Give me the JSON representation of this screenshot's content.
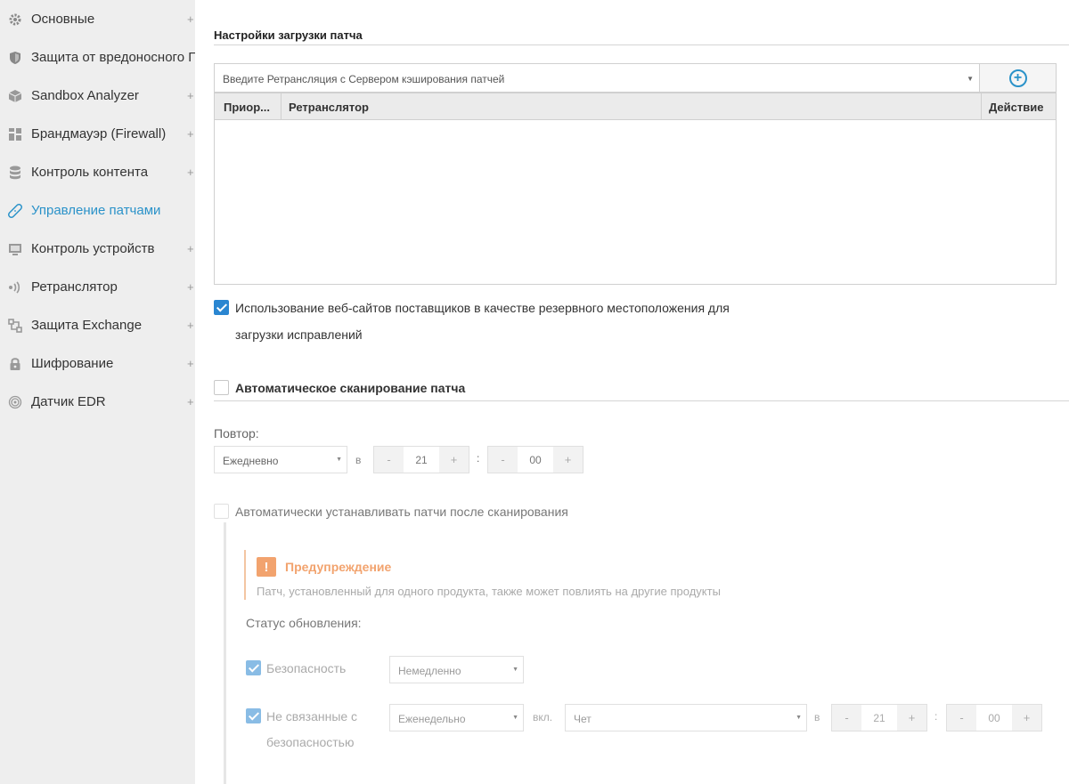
{
  "sidebar": {
    "items": [
      {
        "label": "Основные",
        "icon": "gear-icon",
        "plus": "+"
      },
      {
        "label": "Защита от вредоносного ПО",
        "icon": "shield-icon",
        "plus": "+"
      },
      {
        "label": "Sandbox Analyzer",
        "icon": "cube-icon",
        "plus": "+"
      },
      {
        "label": "Брандмауэр (Firewall)",
        "icon": "firewall-icon",
        "plus": "+"
      },
      {
        "label": "Контроль контента",
        "icon": "database-icon",
        "plus": "+"
      },
      {
        "label": "Управление патчами",
        "icon": "bandage-icon",
        "plus": ""
      },
      {
        "label": "Контроль устройств",
        "icon": "monitor-icon",
        "plus": "+"
      },
      {
        "label": "Ретранслятор",
        "icon": "broadcast-icon",
        "plus": "+"
      },
      {
        "label": "Защита Exchange",
        "icon": "exchange-icon",
        "plus": "+"
      },
      {
        "label": "Шифрование",
        "icon": "lock-icon",
        "plus": "+"
      },
      {
        "label": "Датчик EDR",
        "icon": "sensor-icon",
        "plus": "+"
      }
    ]
  },
  "main": {
    "section_title": "Настройки загрузки патча",
    "relay_combo_placeholder": "Введите Ретрансляция с Сервером кэширования патчей",
    "table": {
      "columns": [
        "Приор...",
        "Ретранслятор",
        "Действие"
      ],
      "rows": []
    },
    "vendor_fallback": {
      "checked": true,
      "label_line1": "Использование веб-сайтов поставщиков в качестве резервного местоположения для",
      "label_line2": "загрузки исправлений"
    },
    "auto_scan": {
      "checked": false,
      "label": "Автоматическое сканирование патча"
    },
    "repeat": {
      "label": "Повтор:",
      "value": "Ежедневно",
      "at": "в",
      "hour": "21",
      "colon": ":",
      "minute": "00",
      "minus": "-",
      "plus": "+"
    },
    "auto_install": {
      "checked": false,
      "label": "Автоматически устанавливать патчи после сканирования"
    },
    "warning": {
      "icon": "!",
      "title": "Предупреждение",
      "text": "Патч, установленный для одного продукта, также может повлиять на другие продукты"
    },
    "update_status": {
      "label": "Статус обновления:",
      "security": {
        "checked": true,
        "label": "Безопасность",
        "value": "Немедленно"
      },
      "non_security": {
        "checked": true,
        "label_line1": "Не связанные с",
        "label_line2": "безопасностью",
        "value": "Еженедельно",
        "on": "вкл.",
        "day": "Чет",
        "at": "в",
        "hour": "21",
        "colon": ":",
        "minute": "00"
      }
    }
  },
  "colors": {
    "accent": "#2a92c9",
    "checkbox": "#2a86d1",
    "warning": "#f2a36e",
    "sidebar_bg": "#eeeeee"
  }
}
